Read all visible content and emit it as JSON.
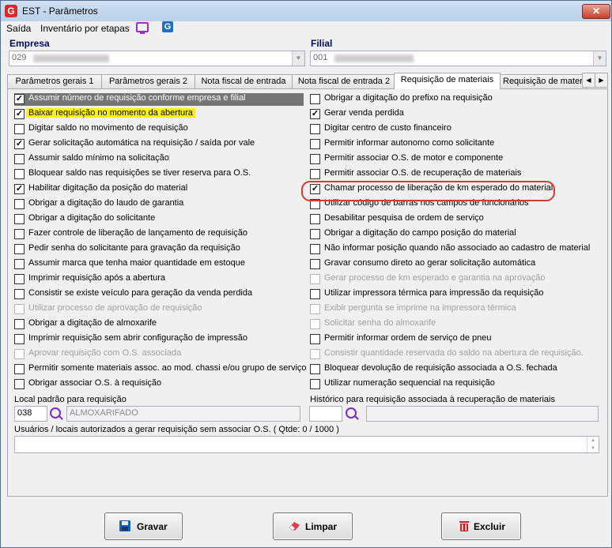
{
  "window": {
    "title": "EST - Parâmetros",
    "close_glyph": "✕"
  },
  "menu": {
    "items": [
      "Saída",
      "Inventário por etapas"
    ]
  },
  "empresa": {
    "label": "Empresa",
    "value": "029"
  },
  "filial": {
    "label": "Filial",
    "value": "001"
  },
  "tabs": [
    "Parâmetros gerais 1",
    "Parâmetros gerais 2",
    "Nota fiscal de entrada",
    "Nota fiscal de entrada 2",
    "Requisição de materiais",
    "Requisição de materi"
  ],
  "active_tab": 4,
  "left_options": [
    {
      "label": "Assumir número de requisição conforme empresa e filial",
      "checked": true,
      "disabled": false,
      "selected": true
    },
    {
      "label": "Baixar requisição no momento da abertura",
      "checked": true,
      "disabled": false,
      "highlight": true
    },
    {
      "label": "Digitar saldo no movimento de requisição",
      "checked": false,
      "disabled": false
    },
    {
      "label": "Gerar solicitação automática na requisição / saída por vale",
      "checked": true,
      "disabled": false
    },
    {
      "label": "Assumir saldo mínimo na solicitação",
      "checked": false,
      "disabled": false
    },
    {
      "label": "Bloquear saldo nas requisições se tiver reserva para O.S.",
      "checked": false,
      "disabled": false
    },
    {
      "label": "Habilitar digitação da posição do material",
      "checked": true,
      "disabled": false
    },
    {
      "label": "Obrigar a digitação do laudo de garantia",
      "checked": false,
      "disabled": false
    },
    {
      "label": "Obrigar a digitação do solicitante",
      "checked": false,
      "disabled": false
    },
    {
      "label": "Fazer controle de liberação de lançamento de requisição",
      "checked": false,
      "disabled": false
    },
    {
      "label": "Pedir senha do solicitante para gravação da requisição",
      "checked": false,
      "disabled": false
    },
    {
      "label": "Assumir marca que tenha maior quantidade em estoque",
      "checked": false,
      "disabled": false
    },
    {
      "label": "Imprimir requisição após a abertura",
      "checked": false,
      "disabled": false
    },
    {
      "label": "Consistir se existe veículo para geração da venda perdida",
      "checked": false,
      "disabled": false
    },
    {
      "label": "Utilizar processo de aprovação de requisição",
      "checked": false,
      "disabled": true
    },
    {
      "label": "Obrigar a digitação de almoxarife",
      "checked": false,
      "disabled": false
    },
    {
      "label": "Imprimir requisição sem abrir configuração de impressão",
      "checked": false,
      "disabled": false
    },
    {
      "label": "Aprovar requisição com O.S. associada",
      "checked": false,
      "disabled": true
    },
    {
      "label": "Permitir somente materiais assoc. ao mod. chassi e/ou grupo de serviço",
      "checked": false,
      "disabled": false
    },
    {
      "label": "Obrigar associar O.S. à requisição",
      "checked": false,
      "disabled": false
    }
  ],
  "right_options": [
    {
      "label": "Obrigar a digitação do prefixo na requisição",
      "checked": false,
      "disabled": false
    },
    {
      "label": "Gerar venda perdida",
      "checked": true,
      "disabled": false
    },
    {
      "label": "Digitar centro de custo financeiro",
      "checked": false,
      "disabled": false
    },
    {
      "label": "Permitir informar autonomo como solicitante",
      "checked": false,
      "disabled": false
    },
    {
      "label": "Permitir associar O.S. de motor e componente",
      "checked": false,
      "disabled": false
    },
    {
      "label": "Permitir associar O.S. de recuperação de materiais",
      "checked": false,
      "disabled": false
    },
    {
      "label": "Chamar processo de liberação de km esperado do material",
      "checked": true,
      "disabled": false,
      "circled": true
    },
    {
      "label": "Utilizar código de barras nos campos de funcionários",
      "checked": false,
      "disabled": false
    },
    {
      "label": "Desabilitar pesquisa de ordem de serviço",
      "checked": false,
      "disabled": false
    },
    {
      "label": "Obrigar a digitação do campo posição do material",
      "checked": false,
      "disabled": false
    },
    {
      "label": "Não informar posição quando não associado ao cadastro de material",
      "checked": false,
      "disabled": false
    },
    {
      "label": "Gravar consumo direto ao gerar solicitação automática",
      "checked": false,
      "disabled": false
    },
    {
      "label": "Gerar processo de km esperado e garantia na aprovação",
      "checked": false,
      "disabled": true
    },
    {
      "label": "Utilizar impressora térmica para impressão da requisição",
      "checked": false,
      "disabled": false
    },
    {
      "label": "Exibir pergunta se imprime na impressora térmica",
      "checked": false,
      "disabled": true
    },
    {
      "label": "Solicitar senha do almoxarife",
      "checked": false,
      "disabled": true
    },
    {
      "label": "Permitir informar ordem de serviço de pneu",
      "checked": false,
      "disabled": false
    },
    {
      "label": "Consistir quantidade reservada do saldo na abertura de requisição.",
      "checked": false,
      "disabled": true
    },
    {
      "label": "Bloquear devolução de requisição associada a O.S. fechada",
      "checked": false,
      "disabled": false
    },
    {
      "label": "Utilizar numeração sequencial na requisição",
      "checked": false,
      "disabled": false
    }
  ],
  "local_padrao": {
    "label": "Local padrão para requisição",
    "code": "038",
    "name": "ALMOXARIFADO"
  },
  "historico": {
    "label": "Histórico para requisição associada à recuperação de materiais",
    "code": "",
    "name": ""
  },
  "usuarios": {
    "label": "Usuários / locais autorizados a gerar requisição sem associar O.S.   ( Qtde: 0 / 1000 )",
    "value": ""
  },
  "buttons": {
    "save": "Gravar",
    "clear": "Limpar",
    "delete": "Excluir"
  },
  "colors": {
    "highlight": "#fff500",
    "ring": "#d63a30",
    "selected_row": "#757575",
    "group_label": "#000c5a"
  }
}
